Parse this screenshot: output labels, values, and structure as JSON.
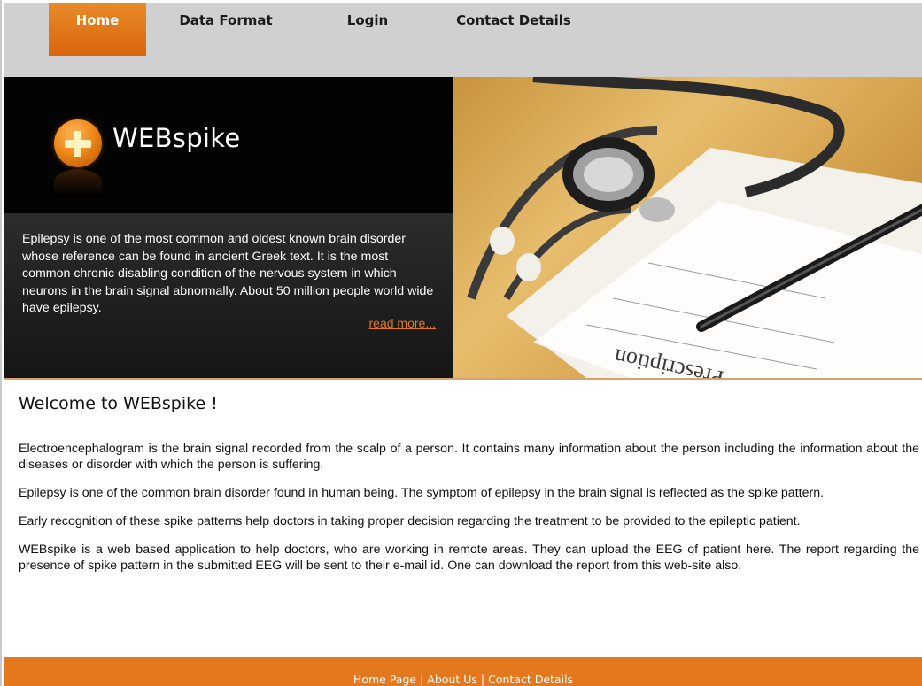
{
  "nav": {
    "items": [
      {
        "label": "Home",
        "active": true
      },
      {
        "label": "Data Format",
        "active": false
      },
      {
        "label": "Login",
        "active": false
      },
      {
        "label": "Contact Details",
        "active": false
      }
    ]
  },
  "hero": {
    "brand": "WEBspike",
    "intro": "Epilepsy is one of the most common and oldest known brain disorder whose reference can be found in ancient Greek text. It is the most common chronic disabling condition of the nervous system in which neurons in the brain signal abnormally. About 50 million people world wide have epilepsy.",
    "read_more": "read more...",
    "image_text": "Prescription"
  },
  "main": {
    "title": "Welcome to WEBspike !",
    "paragraphs": [
      "Electroencephalogram is the brain signal recorded from the scalp of a person. It contains many information about the person including the information about the diseases or disorder with which the person is suffering.",
      "Epilepsy is one of the common brain disorder found in human being. The symptom of epilepsy in the brain signal is reflected as the spike pattern.",
      "Early recognition of these spike patterns help doctors in taking proper decision regarding the treatment to be provided to the epileptic patient.",
      "WEBspike is a web based application to help doctors, who are working in remote areas. They can upload the EEG of patient here. The report regarding the presence of spike pattern in the submitted EEG will be sent to their e-mail id. One can download the report from this web-site also."
    ]
  },
  "footer": {
    "links": [
      "Home Page",
      "About Us",
      "Contact Details"
    ],
    "separator": "|"
  },
  "colors": {
    "accent": "#e4781f",
    "nav_bg": "#d0d0d0",
    "hero_dark": "#000000"
  }
}
